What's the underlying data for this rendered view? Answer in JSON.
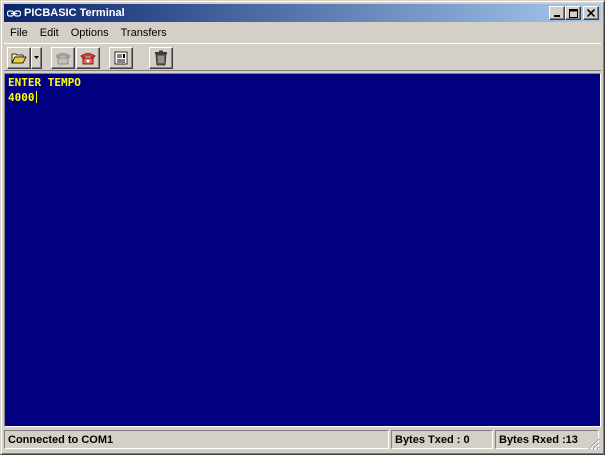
{
  "window": {
    "title": "PICBASIC Terminal",
    "minimize_label": "_",
    "maximize_label": "□",
    "close_label": "×"
  },
  "menu": {
    "items": [
      "File",
      "Edit",
      "Options",
      "Transfers"
    ]
  },
  "toolbar": {
    "buttons": [
      "open-folder-icon",
      "dropdown-arrow-icon",
      "connect-phone-icon",
      "hangup-phone-icon",
      "properties-icon",
      "trash-icon"
    ]
  },
  "terminal": {
    "lines": [
      "ENTER TEMPO",
      "4000"
    ],
    "background_color": "#000080",
    "text_color": "#ffff00"
  },
  "status": {
    "connection": "Connected to COM1",
    "bytes_txed": "Bytes Txed : 0",
    "bytes_rxed": "Bytes Rxed :13"
  },
  "colors": {
    "title_start": "#0a246a",
    "title_end": "#a6caf0",
    "face": "#d4d0c8"
  }
}
